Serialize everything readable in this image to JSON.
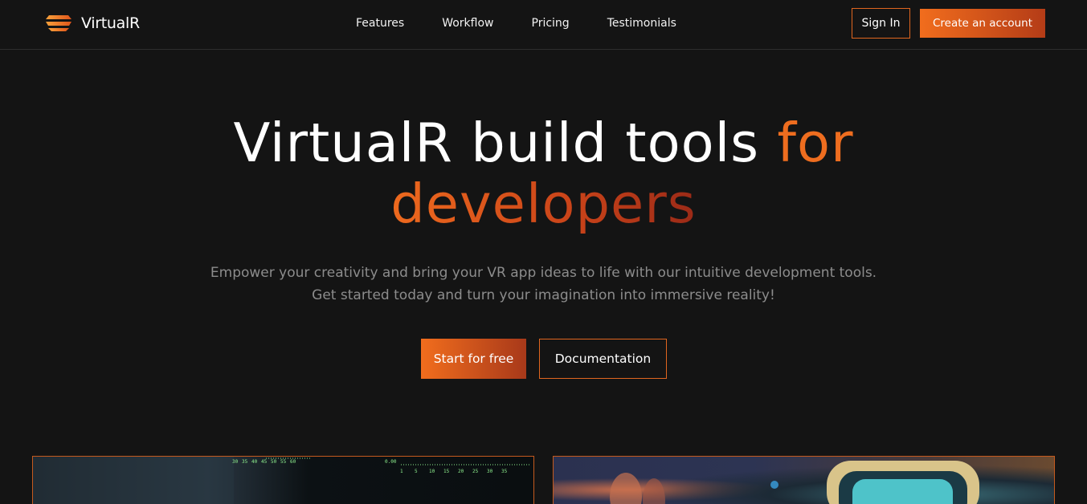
{
  "brand": {
    "name": "VirtualR",
    "logo_icon": "stacked-layers-icon"
  },
  "nav": {
    "links": [
      "Features",
      "Workflow",
      "Pricing",
      "Testimonials"
    ],
    "sign_in": "Sign In",
    "create_account": "Create an account"
  },
  "hero": {
    "title_plain": "VirtualR build tools ",
    "title_accent_1": "for",
    "title_accent_2": "developers",
    "subtitle_line_1": "Empower your creativity and bring your VR app ideas to life with our intuitive development tools.",
    "subtitle_line_2": "Get started today and turn your imagination into immersive reality!",
    "primary_cta": "Start for free",
    "secondary_cta": "Documentation"
  },
  "cards": {
    "left_ticks_top": [
      "30",
      "35",
      "40",
      "45",
      "50",
      "55",
      "60"
    ],
    "left_readout": "0.00",
    "left_ticks_bottom": [
      "1",
      "5",
      "10",
      "15",
      "20",
      "25",
      "30",
      "35"
    ]
  },
  "colors": {
    "background": "#141414",
    "accent": "#ee6d1f",
    "accent_dark": "#a8391a",
    "muted_text": "#8c8c8c"
  }
}
